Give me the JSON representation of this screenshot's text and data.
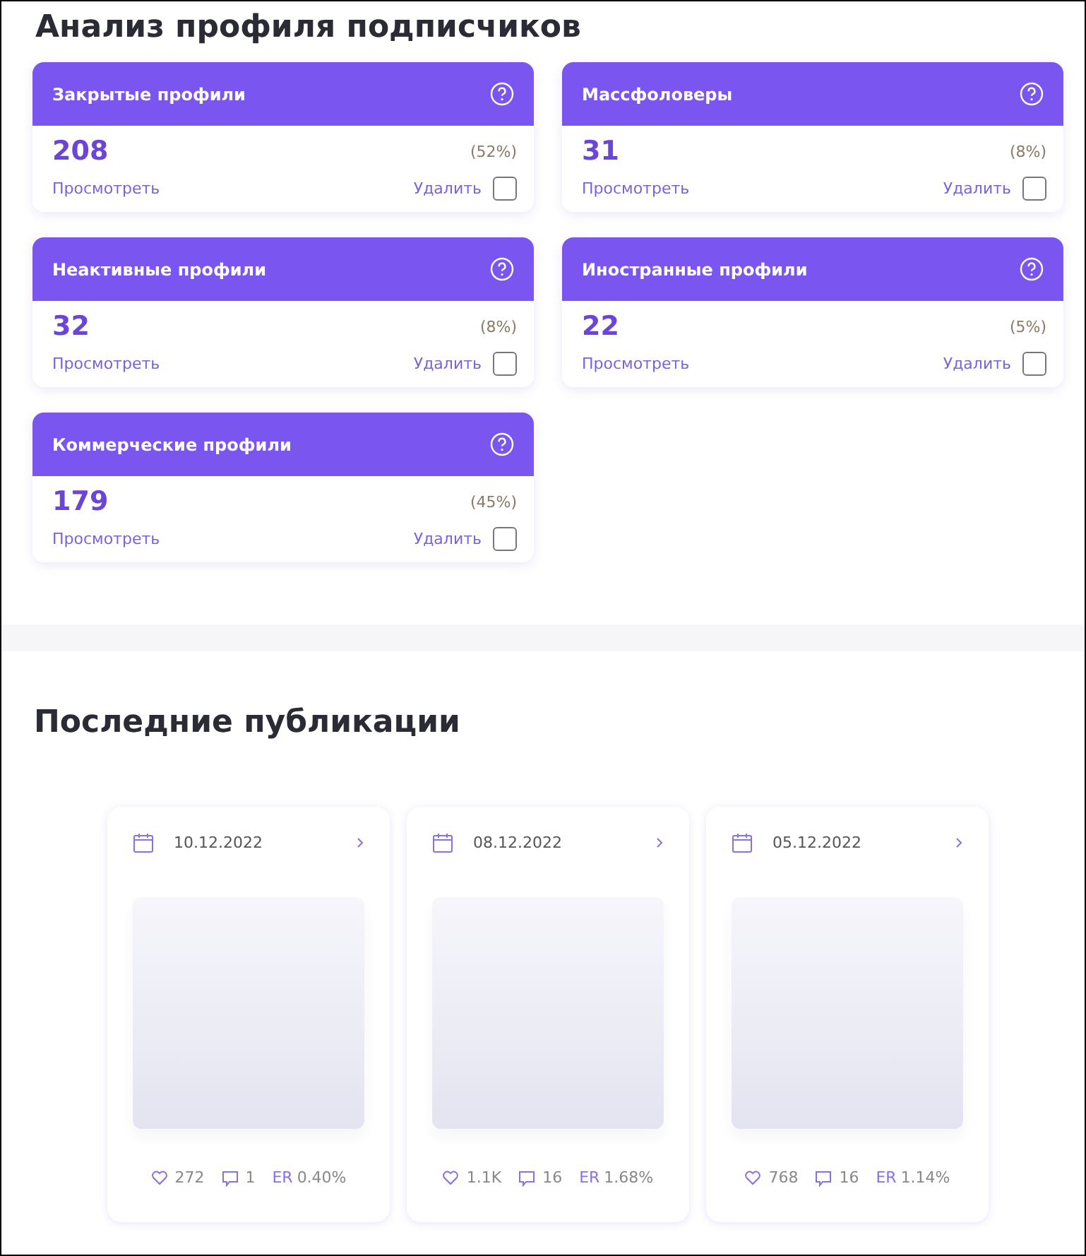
{
  "analysis": {
    "title": "Анализ профиля подписчиков",
    "cards": [
      {
        "title": "Закрытые профили",
        "count": "208",
        "percent": "(52%)",
        "view_link": "Просмотреть",
        "delete_label": "Удалить",
        "checked": false
      },
      {
        "title": "Массфоловеры",
        "count": "31",
        "percent": "(8%)",
        "view_link": "Просмотреть",
        "delete_label": "Удалить",
        "checked": false
      },
      {
        "title": "Неактивные профили",
        "count": "32",
        "percent": "(8%)",
        "view_link": "Просмотреть",
        "delete_label": "Удалить",
        "checked": false
      },
      {
        "title": "Иностранные профили",
        "count": "22",
        "percent": "(5%)",
        "view_link": "Просмотреть",
        "delete_label": "Удалить",
        "checked": false
      },
      {
        "title": "Коммерческие профили",
        "count": "179",
        "percent": "(45%)",
        "view_link": "Просмотреть",
        "delete_label": "Удалить",
        "checked": false
      }
    ]
  },
  "publications": {
    "title": "Последние публикации",
    "posts": [
      {
        "date": "10.12.2022",
        "likes": "272",
        "comments": "1",
        "er_label": "ER",
        "er": "0.40%"
      },
      {
        "date": "08.12.2022",
        "likes": "1.1K",
        "comments": "16",
        "er_label": "ER",
        "er": "1.68%"
      },
      {
        "date": "05.12.2022",
        "likes": "768",
        "comments": "16",
        "er_label": "ER",
        "er": "1.14%"
      }
    ]
  }
}
